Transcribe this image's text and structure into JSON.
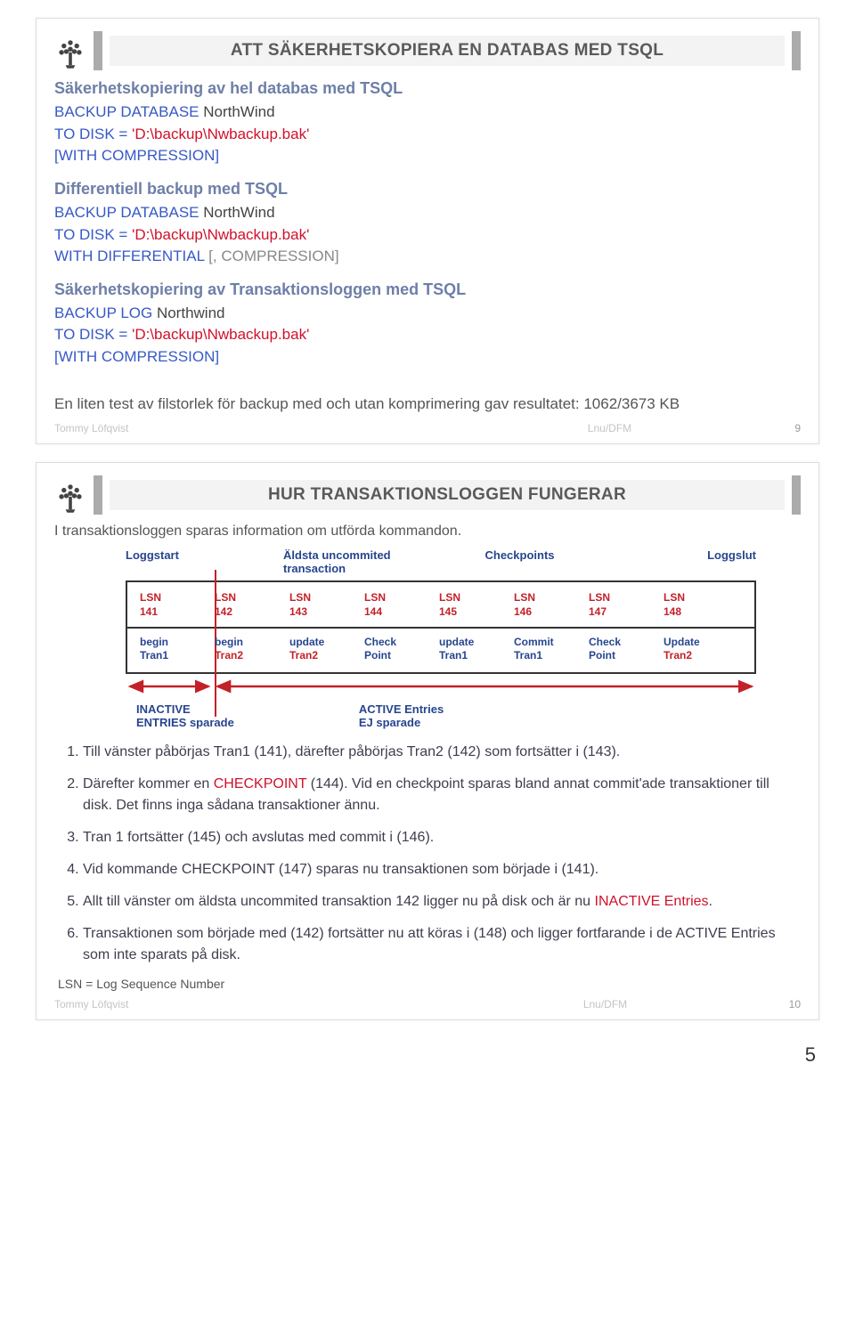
{
  "slide1": {
    "title": "ATT SÄKERHETSKOPIERA EN DATABAS MED TSQL",
    "section1_heading": "Säkerhetskopiering av hel databas med TSQL",
    "code1_l1a": "BACKUP DATABASE ",
    "code1_l1b": "NorthWind",
    "code1_l2a": "TO DISK = ",
    "code1_l2b": "'D:\\backup\\Nwbackup.bak'",
    "code1_l3": "[WITH COMPRESSION]",
    "section2_heading": "Differentiell backup med TSQL",
    "code2_l1a": "BACKUP DATABASE ",
    "code2_l1b": "NorthWind",
    "code2_l2a": "TO DISK = ",
    "code2_l2b": "'D:\\backup\\Nwbackup.bak'",
    "code2_l3a": "WITH DIFFERENTIAL ",
    "code2_l3b": "[, COMPRESSION]",
    "section3_heading": "Säkerhetskopiering av Transaktionsloggen med TSQL",
    "code3_l1a": "BACKUP LOG ",
    "code3_l1b": "Northwind",
    "code3_l2a": "TO DISK = ",
    "code3_l2b": "'D:\\backup\\Nwbackup.bak'",
    "code3_l3": "[WITH COMPRESSION]",
    "result_text": "En liten test av filstorlek för backup med och utan komprimering gav resultatet: 1062/3673 KB",
    "footer_left": "Tommy Löfqvist",
    "footer_center": "Lnu/DFM",
    "footer_right": "9"
  },
  "slide2": {
    "title": "HUR TRANSAKTIONSLOGGEN FUNGERAR",
    "intro": "I transaktionsloggen sparas information om utförda kommandon.",
    "labels": {
      "loggstart": "Loggstart",
      "aldsta": "Äldsta uncommited transaction",
      "checkpoints": "Checkpoints",
      "loggslut": "Loggslut"
    },
    "lsns": [
      {
        "lsn": "LSN",
        "n": "141",
        "op": "begin",
        "tr": "Tran1",
        "trc": "blue"
      },
      {
        "lsn": "LSN",
        "n": "142",
        "op": "begin",
        "tr": "Tran2",
        "trc": "red"
      },
      {
        "lsn": "LSN",
        "n": "143",
        "op": "update",
        "tr": "Tran2",
        "trc": "red"
      },
      {
        "lsn": "LSN",
        "n": "144",
        "op": "Check",
        "tr": "Point",
        "trc": "blue"
      },
      {
        "lsn": "LSN",
        "n": "145",
        "op": "update",
        "tr": "Tran1",
        "trc": "blue"
      },
      {
        "lsn": "LSN",
        "n": "146",
        "op": "Commit",
        "tr": "Tran1",
        "trc": "blue"
      },
      {
        "lsn": "LSN",
        "n": "147",
        "op": "Check",
        "tr": "Point",
        "trc": "blue"
      },
      {
        "lsn": "LSN",
        "n": "148",
        "op": "Update",
        "tr": "Tran2",
        "trc": "red"
      }
    ],
    "inactive_l1": "INACTIVE",
    "inactive_l2": "ENTRIES  sparade",
    "active_l1": "ACTIVE Entries",
    "active_l2": "EJ sparade",
    "steps": [
      "Till vänster påbörjas Tran1 (141), därefter påbörjas Tran2 (142) som fortsätter i (143).",
      "Därefter kommer en CHECKPOINT (144). Vid en checkpoint sparas bland annat commit'ade transaktioner till disk. Det finns inga sådana transaktioner ännu.",
      "Tran 1 fortsätter (145) och avslutas med commit i (146).",
      "Vid kommande CHECKPOINT (147) sparas nu transaktionen som började i (141).",
      "Allt till vänster om äldsta uncommited transaktion 142 ligger nu på disk och är nu INACTIVE Entries.",
      "Transaktionen som började med (142) fortsätter nu att köras i (148) och ligger fortfarande i de ACTIVE Entries som inte sparats på disk."
    ],
    "step2_prefix": "Därefter kommer en ",
    "step2_checkpoint": "CHECKPOINT",
    "step2_rest": " (144). Vid en checkpoint sparas bland annat commit'ade transaktioner till disk. Det finns inga sådana transaktioner ännu.",
    "step5_prefix": "Allt till vänster om äldsta uncommited transaktion 142 ligger nu på disk och är nu ",
    "step5_inactive": "INACTIVE Entries",
    "step5_suffix": ".",
    "note": "LSN = Log Sequence Number",
    "footer_left": "Tommy Löfqvist",
    "footer_center": "Lnu/DFM",
    "footer_right": "10"
  },
  "page_number": "5"
}
